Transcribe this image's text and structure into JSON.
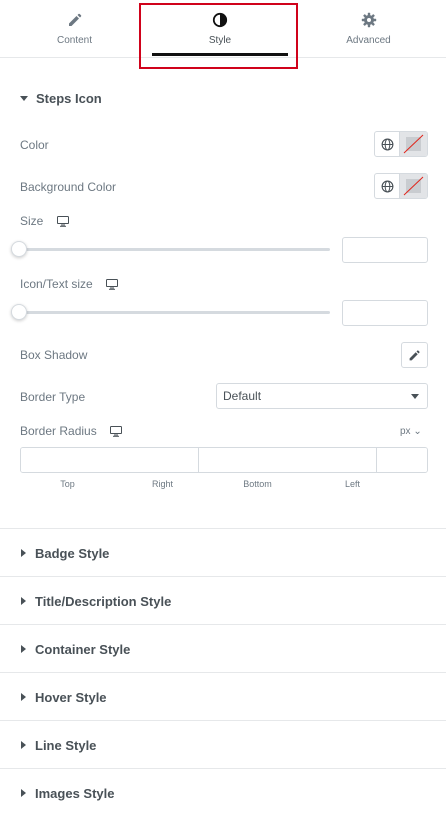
{
  "tabs": [
    {
      "label": "Content",
      "icon": "pencil-icon"
    },
    {
      "label": "Style",
      "icon": "half-circle-icon"
    },
    {
      "label": "Advanced",
      "icon": "gear-icon"
    }
  ],
  "active_tab": "Style",
  "steps_icon": {
    "title": "Steps Icon",
    "color_label": "Color",
    "background_color_label": "Background Color",
    "size_label": "Size",
    "size_value": "",
    "icon_text_size_label": "Icon/Text size",
    "icon_text_size_value": "",
    "box_shadow_label": "Box Shadow",
    "border_type_label": "Border Type",
    "border_type_value": "Default",
    "border_radius_label": "Border Radius",
    "border_radius_unit": "px ⌄",
    "dimensions": [
      "Top",
      "Right",
      "Bottom",
      "Left"
    ]
  },
  "sections": [
    "Badge Style",
    "Title/Description Style",
    "Container Style",
    "Hover Style",
    "Line Style",
    "Images Style"
  ],
  "colors": {
    "accent": "#111111",
    "highlight": "#d0021b",
    "text": "#6d7882",
    "heading": "#495157",
    "border": "#d5dadf"
  }
}
